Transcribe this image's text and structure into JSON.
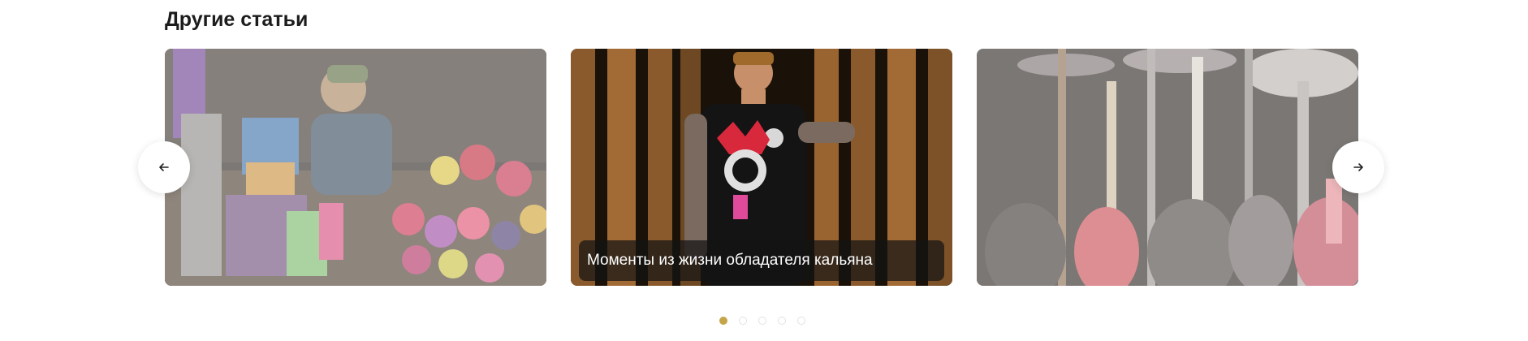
{
  "section": {
    "title": "Другие статьи"
  },
  "carousel": {
    "cards": [
      {
        "image": "tobacco-products-photo",
        "caption": ""
      },
      {
        "image": "man-with-hookah-photo",
        "caption": "Моменты из жизни обладателя кальяна"
      },
      {
        "image": "hookah-collection-photo",
        "caption": ""
      }
    ],
    "prev_icon": "arrow-left-icon",
    "next_icon": "arrow-right-icon",
    "dots_count": 5,
    "active_dot": 1
  },
  "colors": {
    "accent": "#c5a44a",
    "title": "#1c1c1c",
    "caption_bg": "#141414"
  }
}
